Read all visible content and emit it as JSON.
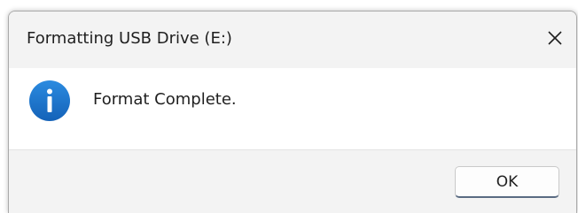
{
  "dialog": {
    "title": "Formatting USB Drive (E:)",
    "message": "Format Complete.",
    "ok_label": "OK",
    "icon": "info-icon",
    "close_icon": "close-icon"
  },
  "colors": {
    "info_icon": "#1a73c8",
    "ok_focus_border": "#5a6b82",
    "chrome_background": "#f3f3f3"
  }
}
